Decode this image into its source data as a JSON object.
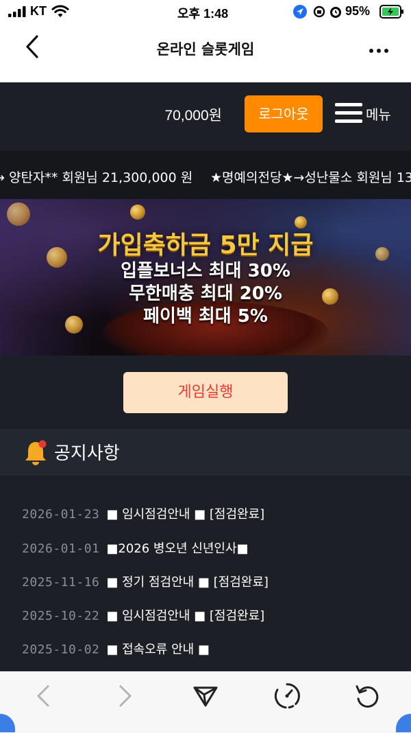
{
  "status_bar": {
    "carrier": "KT",
    "time": "오후 1:48",
    "battery_percent": "95%"
  },
  "nav": {
    "title": "온라인 슬롯게임"
  },
  "header": {
    "balance": "70,000원",
    "logout_label": "로그아웃",
    "menu_label": "메뉴"
  },
  "ticker": {
    "items": [
      "→ 양탄자** 회원님 21,300,000 원",
      "★명예의전당★→성난물소 회원님 13"
    ]
  },
  "banner": {
    "title": "가입축하금 5만 지급",
    "lines": [
      "입플보너스 최대 30%",
      "무한매충 최대 20%",
      "페이백 최대 5%"
    ]
  },
  "game_button_label": "게임실행",
  "notices": {
    "title": "공지사항",
    "items": [
      {
        "date": "2026-01-23",
        "text": "■ 임시점검안내 ■ [점검완료]"
      },
      {
        "date": "2026-01-01",
        "text": "■2026 병오년 신년인사■"
      },
      {
        "date": "2025-11-16",
        "text": "■ 정기 점검안내 ■ [점검완료]"
      },
      {
        "date": "2025-10-22",
        "text": "■ 임시점검안내 ■ [점검완료]"
      },
      {
        "date": "2025-10-02",
        "text": "■ 접속오류 안내 ■"
      }
    ]
  },
  "icons": {
    "back": "chevron-left-icon",
    "more": "more-horizontal-icon",
    "menu": "hamburger-icon",
    "notice": "bell-icon",
    "toolbar": [
      "back-arrow-icon",
      "forward-arrow-icon",
      "send-icon",
      "timer-icon",
      "reload-icon"
    ]
  },
  "colors": {
    "accent_orange": "#ff8a00",
    "game_button_bg": "#fde3c4",
    "game_button_text": "#e53935",
    "header_bg": "#1c1f26",
    "banner_gold": "#f5c742"
  }
}
